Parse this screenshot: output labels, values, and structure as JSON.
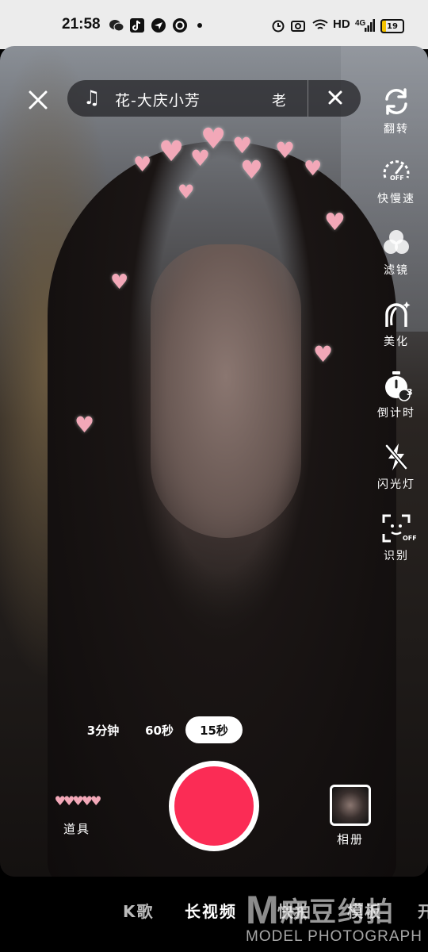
{
  "status_bar": {
    "time": "21:58",
    "network": "HD",
    "signal_type": "4G",
    "battery": "19",
    "notification_icons": [
      "wechat-icon",
      "tiktok-icon",
      "paper-plane-icon",
      "netease-music-icon",
      "dot-icon"
    ],
    "system_icons": [
      "alarm-icon",
      "camera-icon",
      "wifi-icon"
    ]
  },
  "music": {
    "song": "花-大庆小芳",
    "artist": "老"
  },
  "toolbar": {
    "flip": "翻转",
    "speed": "快慢速",
    "filter": "滤镜",
    "beauty": "美化",
    "countdown": "倒计时",
    "flash": "闪光灯",
    "recognize": "识别",
    "speed_badge": "OFF",
    "recognize_badge": "OFF",
    "countdown_badge": "3"
  },
  "durations": [
    {
      "label": "3分钟",
      "active": false
    },
    {
      "label": "60秒",
      "active": false
    },
    {
      "label": "15秒",
      "active": true
    }
  ],
  "bottom": {
    "props_label": "道具",
    "album_label": "相册"
  },
  "modes": [
    {
      "label": "K歌",
      "active": false
    },
    {
      "label": "长视频",
      "active": true
    },
    {
      "label": "快拍",
      "active": false
    },
    {
      "label": "模板",
      "active": false
    },
    {
      "label": "开",
      "active": false
    }
  ],
  "watermark": {
    "logo": "M",
    "cn": "麻豆约拍",
    "en": "MODEL PHOTOGRAPH"
  },
  "colors": {
    "record": "#fb2c55",
    "heart": "#f2a8b8"
  }
}
